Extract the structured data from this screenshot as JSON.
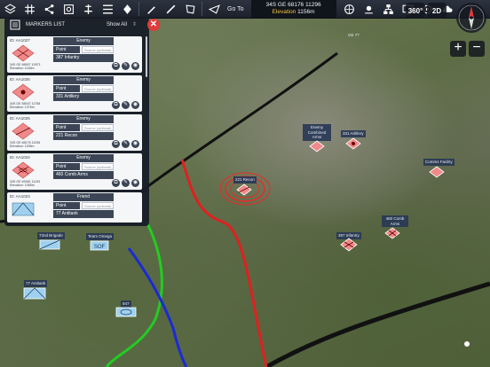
{
  "toolbar": {
    "goto_label": "Go To",
    "coordinate": "34S GE 68176 11296",
    "elevation_label": "Elevation",
    "elevation_value": "1156m",
    "view_3d_label": "360°",
    "view_2d_label": "2D",
    "icons": [
      "layers-icon",
      "grid-icon",
      "share-icon",
      "target-icon",
      "tools-icon",
      "draw-icon",
      "ruler-icon",
      "polygon-icon",
      "send-icon",
      "globe-icon",
      "weather-icon",
      "network-icon",
      "monitor-icon",
      "location-icon",
      "cloud-icon"
    ]
  },
  "panel": {
    "title": "MARKERS LIST",
    "show_all": "Show All",
    "items": [
      {
        "id": "ID: AA1027",
        "affiliation": "Enemy",
        "type": "Point",
        "source_placeholder": "Source (optional)",
        "name": "387 Infantry",
        "grid": "34S GE 68907 10971",
        "elevation": "Elevation: 1146m",
        "symbol": "enemy-infantry"
      },
      {
        "id": "ID: AA1026",
        "affiliation": "Enemy",
        "type": "Point",
        "source_placeholder": "Source (optional)",
        "name": "331 Artillery",
        "grid": "34S GE 68167 11758",
        "elevation": "Elevation: 1376m",
        "symbol": "enemy-artillery"
      },
      {
        "id": "ID: AA1025",
        "affiliation": "Enemy",
        "type": "Point",
        "source_placeholder": "Source (optional)",
        "name": "221 Recon",
        "grid": "34S GE 68176 11296",
        "elevation": "Elevation: 1156m",
        "symbol": "enemy-recon"
      },
      {
        "id": "ID: AA1024",
        "affiliation": "Enemy",
        "type": "Point",
        "source_placeholder": "Source (optional)",
        "name": "460 Comb Arms",
        "grid": "34S GE 69381 11193",
        "elevation": "Elevation: 1085m",
        "symbol": "enemy-combined"
      },
      {
        "id": "ID: AA1023",
        "affiliation": "Friend",
        "type": "Point",
        "source_placeholder": "Source (optional)",
        "name": "77 Antitank",
        "grid": "",
        "elevation": "",
        "symbol": "friend-antitank"
      }
    ]
  },
  "map_markers": [
    {
      "label": "Enemy Combined Arms",
      "kind": "enemy"
    },
    {
      "label": "331 Artillery",
      "kind": "enemy"
    },
    {
      "label": "Comms Facility",
      "kind": "enemy"
    },
    {
      "label": "221 Recon",
      "kind": "enemy"
    },
    {
      "label": "460 Comb Arms",
      "kind": "enemy"
    },
    {
      "label": "387 Infantry",
      "kind": "enemy"
    },
    {
      "label": "72nd Brigade",
      "kind": "friend"
    },
    {
      "label": "Team Omega",
      "kind": "friend"
    },
    {
      "label": "77 Antitank",
      "kind": "friend"
    },
    {
      "label": "947",
      "kind": "friend"
    }
  ],
  "map_text": {
    "grid_label": "GE 77"
  },
  "colors": {
    "enemy": "#f08a8a",
    "friend": "#9fd0f0",
    "toolbar": "#1f2530",
    "close": "#e03a3a"
  }
}
